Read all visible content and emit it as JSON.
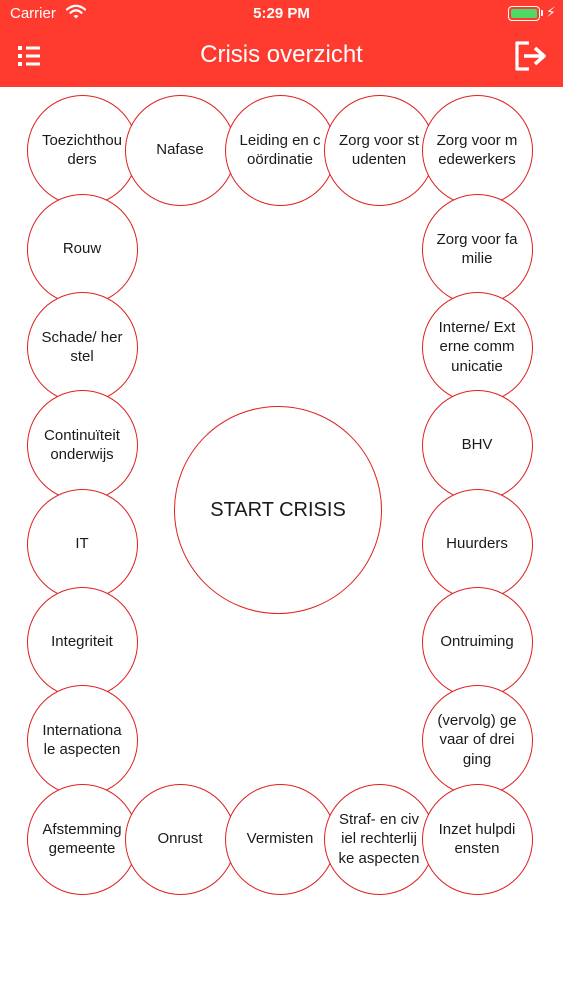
{
  "status_bar": {
    "carrier": "Carrier",
    "time": "5:29 PM"
  },
  "header": {
    "title": "Crisis overzicht"
  },
  "icons": {
    "menu": "list-menu-icon",
    "logout": "logout-icon"
  },
  "colors": {
    "accent": "#ff3b30",
    "circle_border": "#e02020",
    "battery": "#4cd964"
  },
  "start_button": "START CRISIS",
  "topics": [
    "Toezichthouders",
    "Nafase",
    "Leiding en coördinatie",
    "Zorg voor studenten",
    "Zorg voor medewerkers",
    "Rouw",
    "Zorg voor familie",
    "Schade/ herstel",
    "Interne/ Externe communicatie",
    "Continuïteit onderwijs",
    "BHV",
    "IT",
    "Huurders",
    "Integriteit",
    "Ontruiming",
    "Internationale aspecten",
    "(vervolg) gevaar of dreiging",
    "Afstemming gemeente",
    "Onrust",
    "Vermisten",
    "Straf- en civiel rechterlijke aspecten",
    "Inzet hulpdiensten"
  ]
}
